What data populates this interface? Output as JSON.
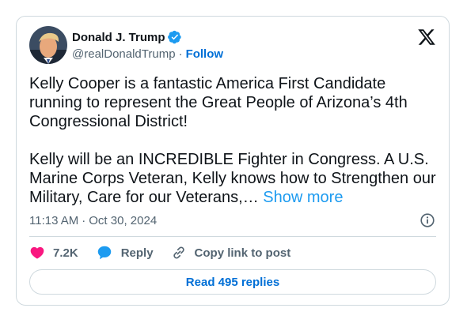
{
  "author": {
    "name": "Donald J. Trump",
    "handle": "@realDonaldTrump",
    "separator": "·",
    "follow_label": "Follow"
  },
  "tweet": {
    "text": "Kelly Cooper is a fantastic America First Candidate running to represent the Great People of Arizona’s 4th Congressional District!\n\nKelly will be an INCREDIBLE Fighter in Congress. A U.S. Marine Corps Veteran, Kelly knows how to Strengthen our Military, Care for our Veterans,…",
    "show_more_label": "Show more",
    "time": "11:13 AM",
    "date_separator": "·",
    "date": "Oct 30, 2024"
  },
  "actions": {
    "likes": "7.2K",
    "reply_label": "Reply",
    "copy_link_label": "Copy link to post"
  },
  "read_replies_label": "Read 495 replies",
  "icons": {
    "verified": "verified-badge-icon",
    "logo": "x-logo-icon",
    "info": "info-icon",
    "like": "heart-icon",
    "reply": "reply-bubble-icon",
    "copy_link": "link-icon"
  },
  "colors": {
    "accent_blue": "#1d9bf0",
    "link_blue": "#006fd6",
    "like_pink": "#f91880",
    "text_primary": "#0f1419",
    "text_secondary": "#536471",
    "border": "#cfd9de"
  }
}
